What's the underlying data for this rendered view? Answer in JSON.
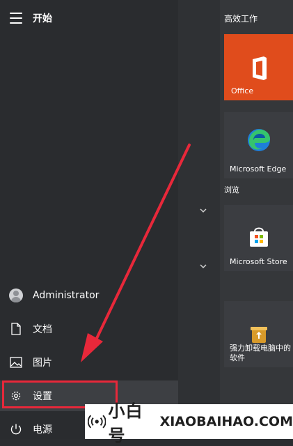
{
  "start": {
    "title": "开始",
    "menu_icon": "hamburger-menu-icon"
  },
  "tiles": {
    "group_title": "高效工作",
    "browse_label": "浏览",
    "items": [
      {
        "label": "Office",
        "icon": "office-icon",
        "color": "#e04c1c"
      },
      {
        "label": "Microsoft Edge",
        "icon": "edge-icon"
      },
      {
        "label": "Microsoft Store",
        "icon": "store-icon"
      },
      {
        "label": "强力卸载电脑中的软件",
        "icon": "uninstall-icon"
      }
    ]
  },
  "menu": {
    "items": [
      {
        "label": "Administrator",
        "icon": "avatar"
      },
      {
        "label": "文档",
        "icon": "document-icon"
      },
      {
        "label": "图片",
        "icon": "picture-icon"
      },
      {
        "label": "设置",
        "icon": "gear-icon"
      },
      {
        "label": "电源",
        "icon": "power-icon"
      }
    ]
  },
  "colors": {
    "accent_red": "#e8283a",
    "office_orange": "#e04c1c"
  },
  "watermark": {
    "cn": "小白号",
    "en": "XIAOBAIHAO.COM"
  }
}
